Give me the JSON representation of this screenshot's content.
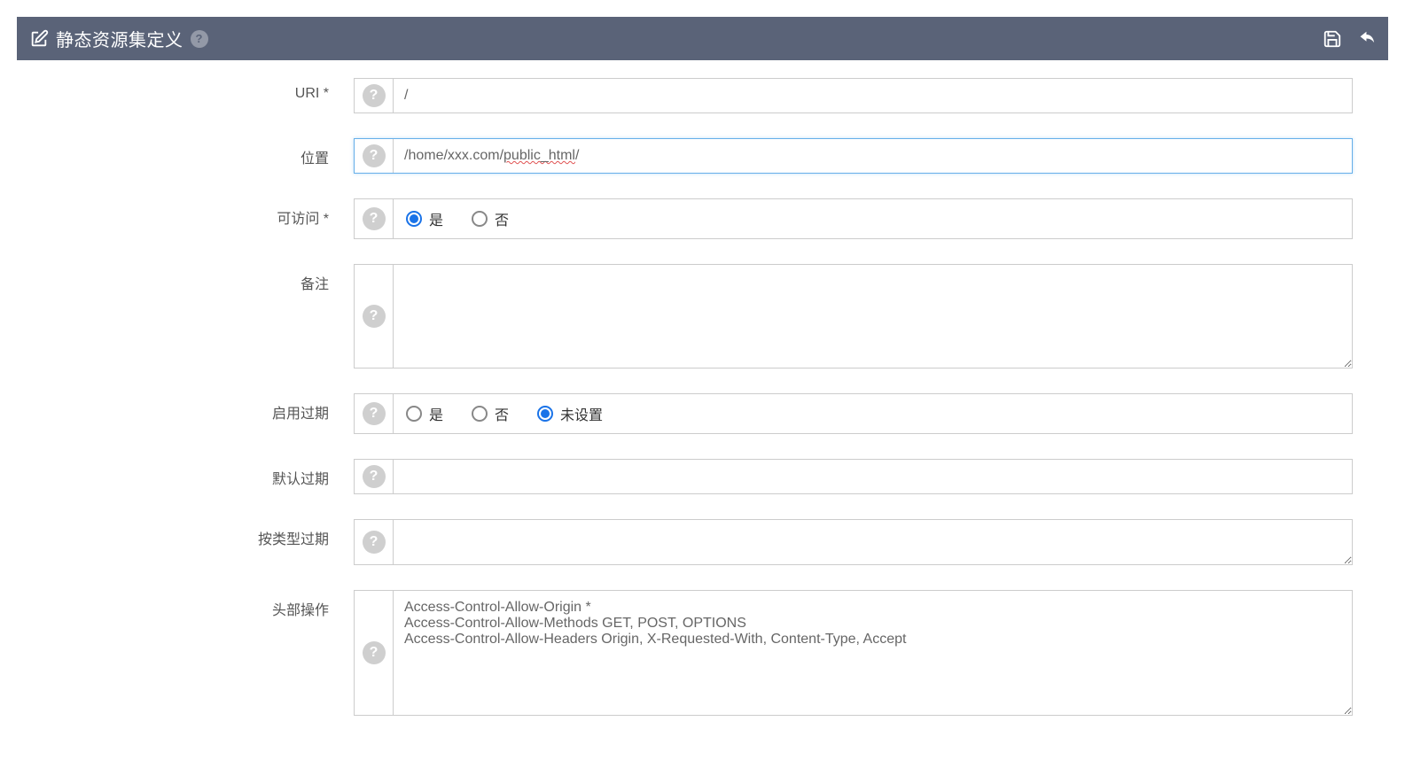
{
  "header": {
    "title": "静态资源集定义"
  },
  "fields": {
    "uri": {
      "label": "URI *",
      "value": "/"
    },
    "location": {
      "label": "位置",
      "value_prefix": "/home/xxx.com/",
      "value_underlined": "public_html",
      "value_suffix": "/"
    },
    "accessible": {
      "label": "可访问 *",
      "options": {
        "yes": "是",
        "no": "否"
      },
      "selected": "yes"
    },
    "note": {
      "label": "备注",
      "value": ""
    },
    "enable_expire": {
      "label": "启用过期",
      "options": {
        "yes": "是",
        "no": "否",
        "unset": "未设置"
      },
      "selected": "unset"
    },
    "default_expire": {
      "label": "默认过期",
      "value": ""
    },
    "expire_by_type": {
      "label": "按类型过期",
      "value": ""
    },
    "header_ops": {
      "label": "头部操作",
      "value": "Access-Control-Allow-Origin *\nAccess-Control-Allow-Methods GET, POST, OPTIONS\nAccess-Control-Allow-Headers Origin, X-Requested-With, Content-Type, Accept"
    }
  }
}
